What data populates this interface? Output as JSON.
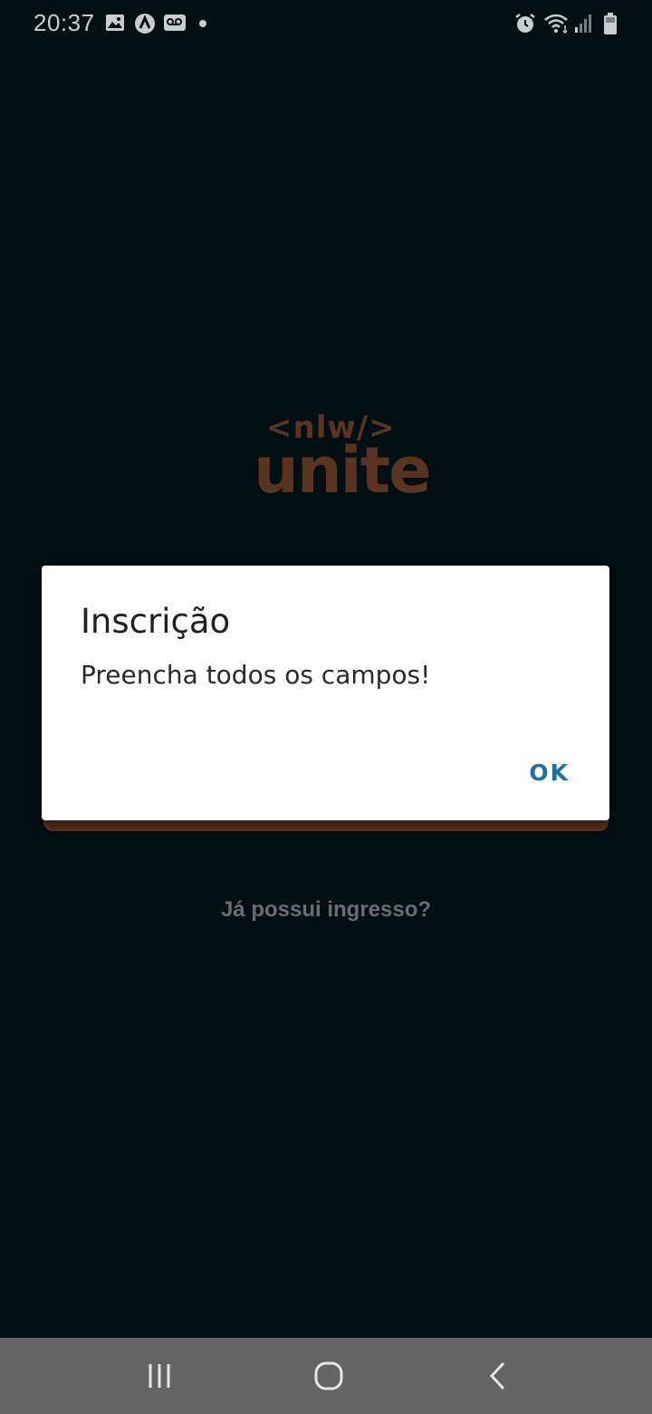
{
  "status_bar": {
    "time": "20:37",
    "left_icons": [
      "image-icon",
      "app-icon",
      "voicemail-icon"
    ],
    "right_icons": [
      "alarm-icon",
      "wifi-icon",
      "signal-icon",
      "battery-icon"
    ]
  },
  "logo": {
    "tag": "<nlw/>",
    "word": "unite"
  },
  "dialog": {
    "title": "Inscrição",
    "message": "Preencha todos os campos!",
    "ok_label": "OK"
  },
  "ticket_link": "Já possui ingresso?",
  "nav_bar": {
    "icons": [
      "recent-apps-icon",
      "home-icon",
      "back-icon"
    ]
  },
  "colors": {
    "background": "#020f13",
    "brand_brown": "#5a3422",
    "dialog_button": "#1e6fa8",
    "nav_bar": "#646464"
  }
}
